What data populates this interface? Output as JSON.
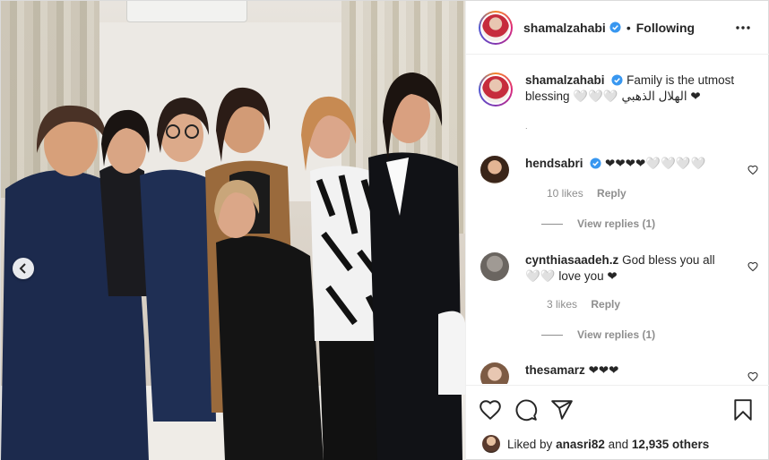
{
  "post": {
    "author": "shamalzahabi",
    "follow_status": "Following",
    "dot": "•",
    "caption_text": "Family is the utmost blessing 🤍🤍🤍 الهلال الذهبي ❤",
    "caption_extra": "˙"
  },
  "comments": [
    {
      "username": "hendsabri",
      "verified": true,
      "text": "❤❤❤❤🤍🤍🤍🤍",
      "likes": "10 likes",
      "reply_label": "Reply",
      "view_replies": "View replies (1)"
    },
    {
      "username": "cynthiasaadeh.z",
      "verified": false,
      "text": "God bless you all 🤍🤍 love you ❤",
      "likes": "3 likes",
      "reply_label": "Reply",
      "view_replies": "View replies (1)"
    },
    {
      "username": "thesamarz",
      "verified": false,
      "text": "❤❤❤"
    }
  ],
  "likes": {
    "prefix": "Liked by",
    "user": "anasri82",
    "and": "and",
    "others": "12,935 others"
  },
  "colors": {
    "verified_blue": "#3897f0",
    "text": "#262626",
    "muted": "#8e8e8e",
    "border": "#efefef"
  },
  "icons": {
    "prev": "chevron-left-icon",
    "more": "more-horizontal-icon",
    "like": "heart-outline-icon",
    "comment": "comment-icon",
    "share": "paper-plane-icon",
    "save": "bookmark-icon"
  }
}
